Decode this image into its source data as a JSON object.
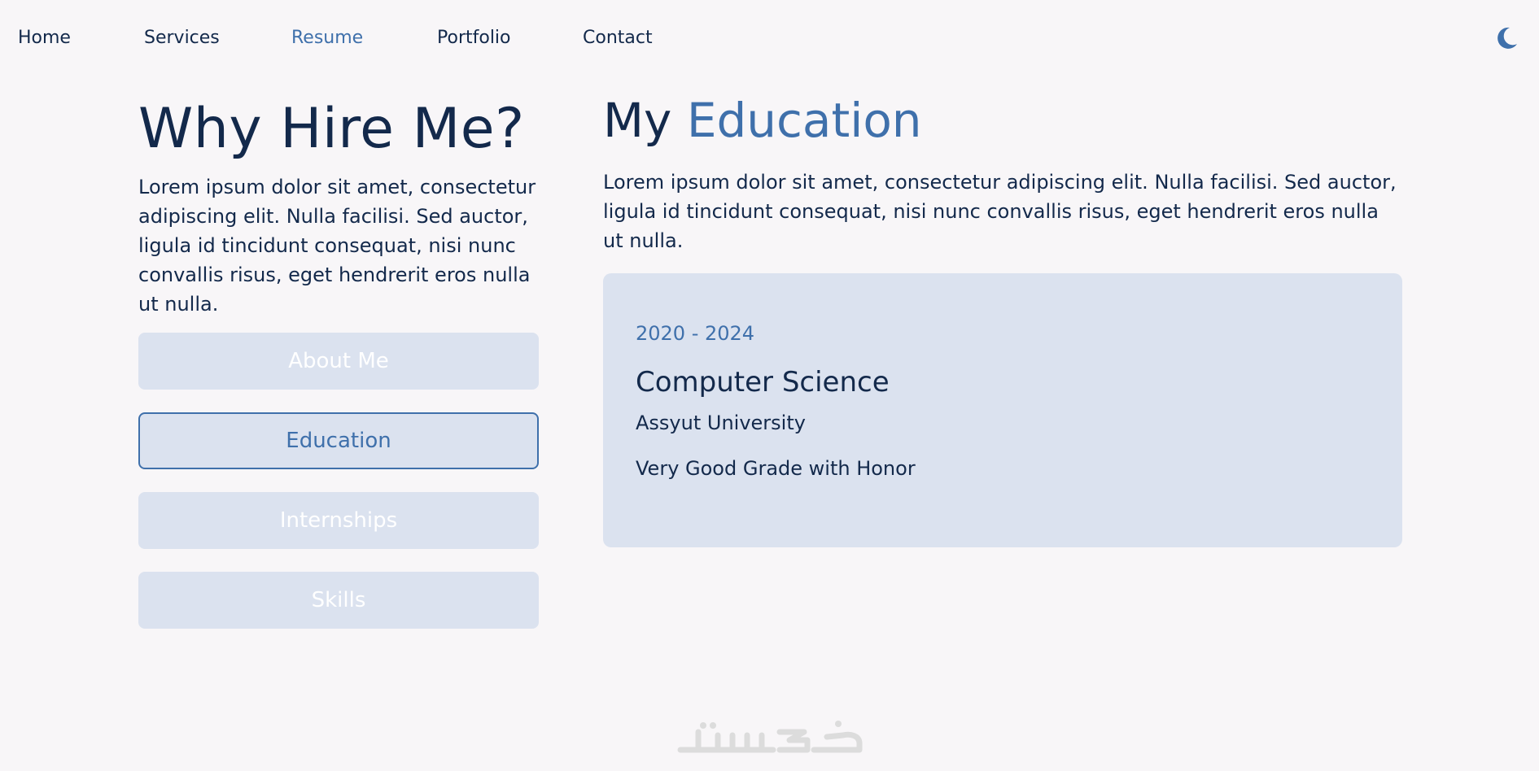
{
  "nav": {
    "items": [
      {
        "label": "Home",
        "active": false
      },
      {
        "label": "Services",
        "active": false
      },
      {
        "label": "Resume",
        "active": true
      },
      {
        "label": "Portfolio",
        "active": false
      },
      {
        "label": "Contact",
        "active": false
      }
    ],
    "theme_icon": "moon-icon"
  },
  "why": {
    "title": "Why Hire Me?",
    "text": "Lorem ipsum dolor sit amet, consectetur adipiscing elit. Nulla facilisi. Sed auctor, ligula id tincidunt consequat, nisi nunc convallis risus, eget hendrerit eros nulla ut nulla."
  },
  "tabs": [
    {
      "label": "About Me",
      "active": false
    },
    {
      "label": "Education",
      "active": true
    },
    {
      "label": "Internships",
      "active": false
    },
    {
      "label": "Skills",
      "active": false
    }
  ],
  "education": {
    "title_prefix": "My",
    "title_accent": "Education",
    "text": "Lorem ipsum dolor sit amet, consectetur adipiscing elit. Nulla facilisi. Sed auctor, ligula id tincidunt consequat, nisi nunc convallis risus, eget hendrerit eros nulla ut nulla.",
    "entries": [
      {
        "years": "2020 - 2024",
        "degree": "Computer Science",
        "school": "Assyut University",
        "grade": "Very Good Grade with Honor"
      }
    ]
  },
  "watermark": {
    "text": "خمسات"
  },
  "colors": {
    "background": "#f8f6f8",
    "text": "#13294b",
    "accent": "#3f70ab",
    "card": "#dbe2ef",
    "watermark": "#dcdcdc"
  }
}
